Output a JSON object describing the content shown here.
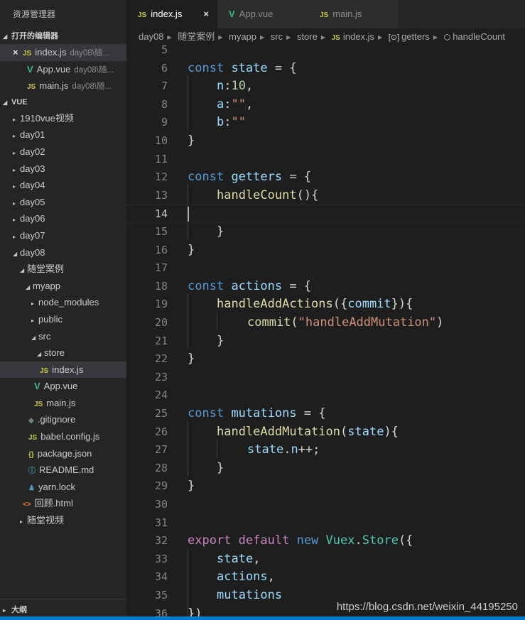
{
  "sidebar": {
    "title": "资源管理器",
    "open_editors": {
      "title": "打开的编辑器",
      "items": [
        {
          "icon": "JS",
          "name": "index.js",
          "desc": "day08\\随..."
        },
        {
          "icon": "V",
          "name": "App.vue",
          "desc": "day08\\随..."
        },
        {
          "icon": "JS",
          "name": "main.js",
          "desc": "day08\\随..."
        }
      ]
    },
    "workspace": {
      "title": "VUE",
      "tree": [
        {
          "label": "1910vue视频",
          "icon": ""
        },
        {
          "label": "day01",
          "icon": ""
        },
        {
          "label": "day02",
          "icon": ""
        },
        {
          "label": "day03",
          "icon": ""
        },
        {
          "label": "day04",
          "icon": ""
        },
        {
          "label": "day05",
          "icon": ""
        },
        {
          "label": "day06",
          "icon": ""
        },
        {
          "label": "day07",
          "icon": ""
        },
        {
          "label": "day08",
          "icon": ""
        },
        {
          "label": "随堂案例",
          "icon": ""
        },
        {
          "label": "myapp",
          "icon": ""
        },
        {
          "label": "node_modules",
          "icon": ""
        },
        {
          "label": "public",
          "icon": ""
        },
        {
          "label": "src",
          "icon": ""
        },
        {
          "label": "store",
          "icon": ""
        },
        {
          "label": "index.js",
          "icon": "JS"
        },
        {
          "label": "App.vue",
          "icon": "V"
        },
        {
          "label": "main.js",
          "icon": "JS"
        },
        {
          "label": ".gitignore",
          "icon": "◆"
        },
        {
          "label": "babel.config.js",
          "icon": "JS"
        },
        {
          "label": "package.json",
          "icon": "{}"
        },
        {
          "label": "README.md",
          "icon": "ⓘ"
        },
        {
          "label": "yarn.lock",
          "icon": "♟"
        },
        {
          "label": "回顾.html",
          "icon": "<>"
        },
        {
          "label": "随堂视频",
          "icon": ""
        }
      ]
    },
    "outline_title": "大纲"
  },
  "tabs": [
    {
      "icon": "JS",
      "label": "index.js",
      "close": "×"
    },
    {
      "icon": "V",
      "label": "App.vue"
    },
    {
      "icon": "JS",
      "label": "main.js"
    }
  ],
  "breadcrumb": {
    "items": [
      "day08",
      "随堂案例",
      "myapp",
      "src",
      "store",
      "index.js",
      "getters",
      "handleCount"
    ],
    "js_icon": "JS",
    "getters_icon": "[⊙]",
    "handlecount_icon": "⬡"
  },
  "editor": {
    "line_numbers": [
      "5",
      "6",
      "7",
      "8",
      "9",
      "10",
      "11",
      "12",
      "13",
      "14",
      "15",
      "16",
      "17",
      "18",
      "19",
      "20",
      "21",
      "22",
      "23",
      "24",
      "25",
      "26",
      "27",
      "28",
      "29",
      "30",
      "31",
      "32",
      "33",
      "34",
      "35",
      "36"
    ],
    "current_line": "14",
    "tokens": {
      "const": "const",
      "state": "state",
      "getters": "getters",
      "actions": "actions",
      "mutations": "mutations",
      "eq_open": " = {",
      "n": "n",
      "a": "a",
      "b": "b",
      "colon": ":",
      "ten": "10",
      "empty_str": "\"\"",
      "comma": ",",
      "close_brace": "}",
      "handleCount": "handleCount",
      "paren_open_brace": "(){",
      "handleAddActions": "handleAddActions",
      "paren_obj_open": "({",
      "commit": "commit",
      "obj_close_brace": "}){",
      "paren_open": "(",
      "mutation_str": "\"handleAddMutation\"",
      "paren_close": ")",
      "handleAddMutation": "handleAddMutation",
      "state_param_close": "){",
      "dot": ".",
      "incr": "++;",
      "export": "export",
      "default": "default",
      "new": "new",
      "Vuex": "Vuex",
      "Store": "Store",
      "store_open": "({",
      "close_paren": "})"
    }
  },
  "watermark": "https://blog.csdn.net/weixin_44195250"
}
